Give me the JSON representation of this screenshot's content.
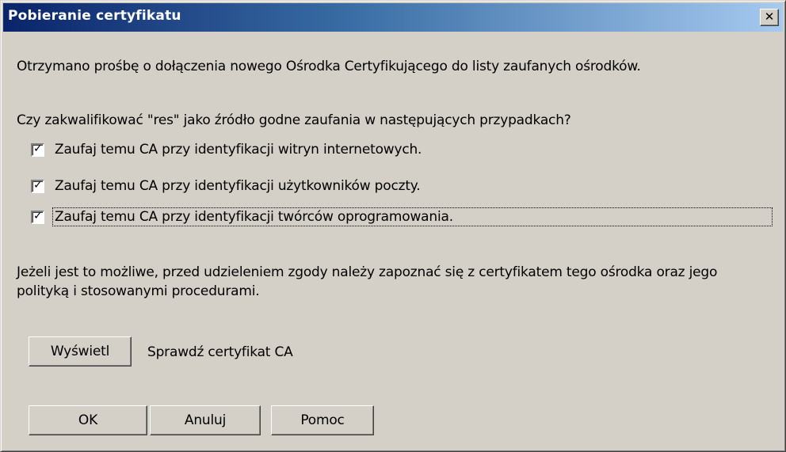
{
  "window": {
    "title": "Pobieranie certyfikatu",
    "close_label": "x"
  },
  "body": {
    "intro": "Otrzymano prośbę o dołączenia nowego Ośrodka Certyfikującego do listy zaufanych ośrodków.",
    "question": "Czy zakwalifikować \"res\" jako źródło godne zaufania w następujących przypadkach?",
    "checkboxes": [
      {
        "label": "Zaufaj temu CA przy identyfikacji witryn internetowych.",
        "checked": true
      },
      {
        "label": "Zaufaj temu CA przy identyfikacji użytkowników poczty.",
        "checked": true
      },
      {
        "label": "Zaufaj temu CA przy identyfikacji twórców oprogramowania.",
        "checked": true
      }
    ],
    "advice": "Jeżeli jest to możliwe, przed udzieleniem zgody należy zapoznać się z certyfikatem tego ośrodka oraz jego polityką i stosowanymi procedurami.",
    "view_button": "Wyświetl",
    "view_caption": "Sprawdź certyfikat CA"
  },
  "footer": {
    "ok": "OK",
    "cancel": "Anuluj",
    "help": "Pomoc"
  },
  "colors": {
    "dialog_bg": "#d4d0c8",
    "titlebar_start": "#0a246a",
    "titlebar_end": "#a6caf0"
  }
}
